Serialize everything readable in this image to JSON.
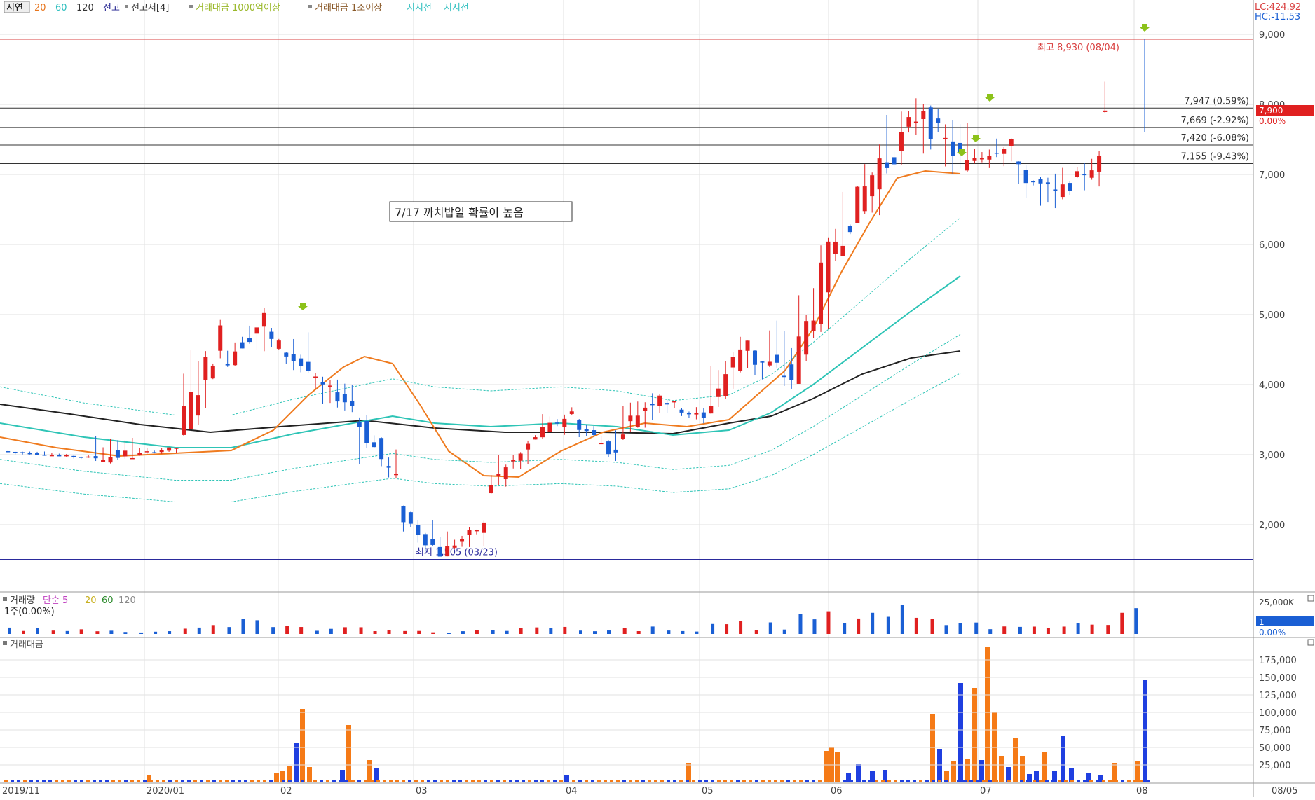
{
  "toolbar": {
    "items": [
      {
        "label": "서연",
        "color": "#000000",
        "boxed": true
      },
      {
        "label": "20",
        "color": "#e8761e"
      },
      {
        "label": "60",
        "color": "#2fbfbf"
      },
      {
        "label": "120",
        "color": "#333333"
      },
      {
        "label": "전고",
        "color": "#1a1a8c"
      },
      {
        "label": "전고저[4]",
        "color": "#333333"
      },
      {
        "label": "거래대금 1000억이상",
        "color": "#9ab82a"
      },
      {
        "label": "거래대금 1조이상",
        "color": "#8a5a2a"
      },
      {
        "label": "지지선",
        "color": "#2fbfbf"
      },
      {
        "label": "지지선",
        "color": "#2fbfbf"
      }
    ]
  },
  "top_right": {
    "lc": "LC:424.92",
    "hc": "HC:-11.53"
  },
  "price_axis": {
    "ticks": [
      "9,000",
      "8,000",
      "7,000",
      "6,000",
      "5,000",
      "4,000",
      "3,000",
      "2,000"
    ],
    "current_price": "7,900",
    "current_change": "0.00%"
  },
  "levels": [
    {
      "label": "최고 8,930 (08/04)",
      "value": 8930,
      "color": "#d94040"
    },
    {
      "label": "7,947 (0.59%)",
      "value": 7947,
      "color": "#333333"
    },
    {
      "label": "7,669 (-2.92%)",
      "value": 7669,
      "color": "#333333"
    },
    {
      "label": "7,420 (-6.08%)",
      "value": 7420,
      "color": "#333333"
    },
    {
      "label": "7,155 (-9.43%)",
      "value": 7155,
      "color": "#333333"
    },
    {
      "label": "최저 1,505 (03/23)",
      "value": 1505,
      "color": "#2a2a9c"
    }
  ],
  "annotation": {
    "text": "7/17  까치밥일  확률이  높음"
  },
  "volume_panel": {
    "legend": [
      {
        "label": "거래량",
        "color": "#333333"
      },
      {
        "label": "단순 5",
        "color": "#c040c0"
      },
      {
        "label": "20",
        "color": "#c8b020"
      },
      {
        "label": "60",
        "color": "#2a8a2a"
      },
      {
        "label": "120",
        "color": "#888888"
      }
    ],
    "sub": "1주(0.00%)",
    "ticks": [
      "25,000K"
    ],
    "current": "1",
    "current_change": "0.00%"
  },
  "amount_panel": {
    "legend": "거래대금",
    "ticks": [
      "175,000",
      "150,000",
      "125,000",
      "100,000",
      "75,000",
      "50,000",
      "25,000"
    ]
  },
  "x_axis": {
    "labels": [
      "2019/11",
      "2020/01",
      "02",
      "03",
      "04",
      "05",
      "06",
      "07",
      "08",
      "08/05"
    ]
  },
  "colors": {
    "up": "#e02020",
    "down": "#1a5fd4",
    "ma20": "#ef7b1f",
    "ma60": "#2ec4b6",
    "ma120": "#222222",
    "amount_orange": "#f57a16",
    "amount_blue": "#1f3fe0",
    "arrow": "#8cc21a"
  },
  "chart_data": {
    "type": "candlestick",
    "x_range": [
      "2019-11",
      "2020-08-05"
    ],
    "ylim": [
      1500,
      9200
    ],
    "ohlc_weekly_approx": [
      {
        "x": "2019-11",
        "o": 3050,
        "h": 3080,
        "l": 2980,
        "c": 3000
      },
      {
        "x": "2019-12",
        "o": 3000,
        "h": 3050,
        "l": 2920,
        "c": 2960
      },
      {
        "x": "2020-01",
        "o": 2960,
        "h": 3600,
        "l": 2850,
        "c": 3000
      },
      {
        "x": "2020-01b",
        "o": 3000,
        "h": 3150,
        "l": 2980,
        "c": 3100
      },
      {
        "x": "2020-02",
        "o": 3300,
        "h": 5000,
        "l": 3250,
        "c": 4700
      },
      {
        "x": "2020-02b",
        "o": 4300,
        "h": 5400,
        "l": 4200,
        "c": 4950
      },
      {
        "x": "2020-02c",
        "o": 4700,
        "h": 5100,
        "l": 4100,
        "c": 4200
      },
      {
        "x": "2020-03",
        "o": 4100,
        "h": 4200,
        "l": 3500,
        "c": 3700
      },
      {
        "x": "2020-03b",
        "o": 3600,
        "h": 3700,
        "l": 2500,
        "c": 2600
      },
      {
        "x": "2020-03c",
        "o": 2200,
        "h": 2300,
        "l": 1505,
        "c": 1600
      },
      {
        "x": "2020-03d",
        "o": 1600,
        "h": 2100,
        "l": 1550,
        "c": 2000
      },
      {
        "x": "2020-04",
        "o": 2500,
        "h": 3300,
        "l": 2400,
        "c": 3100
      },
      {
        "x": "2020-04b",
        "o": 3200,
        "h": 3800,
        "l": 3200,
        "c": 3600
      },
      {
        "x": "2020-04c",
        "o": 3500,
        "h": 3550,
        "l": 2800,
        "c": 3000
      },
      {
        "x": "2020-05",
        "o": 3300,
        "h": 4100,
        "l": 3200,
        "c": 3900
      },
      {
        "x": "2020-05b",
        "o": 3800,
        "h": 3900,
        "l": 3350,
        "c": 3500
      },
      {
        "x": "2020-06",
        "o": 3600,
        "h": 4900,
        "l": 3550,
        "c": 4700
      },
      {
        "x": "2020-06b",
        "o": 4400,
        "h": 5300,
        "l": 3800,
        "c": 4100
      },
      {
        "x": "2020-06c",
        "o": 4200,
        "h": 6400,
        "l": 4100,
        "c": 6100
      },
      {
        "x": "2020-06d",
        "o": 6000,
        "h": 7700,
        "l": 5900,
        "c": 7200
      },
      {
        "x": "2020-07",
        "o": 7000,
        "h": 8450,
        "l": 6900,
        "c": 8000
      },
      {
        "x": "2020-07b",
        "o": 7800,
        "h": 8100,
        "l": 6700,
        "c": 7100
      },
      {
        "x": "2020-07c",
        "o": 7200,
        "h": 7800,
        "l": 6800,
        "c": 7500
      },
      {
        "x": "2020-07d",
        "o": 7100,
        "h": 7200,
        "l": 6200,
        "c": 6700
      },
      {
        "x": "2020-07e",
        "o": 6700,
        "h": 7400,
        "l": 6600,
        "c": 7200
      },
      {
        "x": "2020-08-04",
        "o": 7900,
        "h": 8930,
        "l": 7600,
        "c": 7900
      }
    ],
    "ma20": [
      [
        0,
        3250
      ],
      [
        80,
        3100
      ],
      [
        170,
        2980
      ],
      [
        250,
        3020
      ],
      [
        330,
        3060
      ],
      [
        390,
        3350
      ],
      [
        440,
        3850
      ],
      [
        490,
        4250
      ],
      [
        520,
        4400
      ],
      [
        560,
        4300
      ],
      [
        600,
        3700
      ],
      [
        640,
        3050
      ],
      [
        690,
        2700
      ],
      [
        740,
        2680
      ],
      [
        800,
        3050
      ],
      [
        860,
        3320
      ],
      [
        920,
        3450
      ],
      [
        980,
        3400
      ],
      [
        1040,
        3500
      ],
      [
        1080,
        3850
      ],
      [
        1120,
        4200
      ],
      [
        1160,
        4800
      ],
      [
        1200,
        5600
      ],
      [
        1240,
        6300
      ],
      [
        1280,
        6950
      ],
      [
        1320,
        7050
      ],
      [
        1370,
        7010
      ]
    ],
    "ma60": [
      [
        0,
        3450
      ],
      [
        120,
        3250
      ],
      [
        250,
        3100
      ],
      [
        330,
        3100
      ],
      [
        420,
        3300
      ],
      [
        520,
        3480
      ],
      [
        560,
        3550
      ],
      [
        620,
        3450
      ],
      [
        700,
        3400
      ],
      [
        800,
        3450
      ],
      [
        880,
        3400
      ],
      [
        960,
        3280
      ],
      [
        1040,
        3350
      ],
      [
        1100,
        3600
      ],
      [
        1160,
        4000
      ],
      [
        1220,
        4450
      ],
      [
        1300,
        5050
      ],
      [
        1370,
        5550
      ]
    ],
    "ma120": [
      [
        0,
        3720
      ],
      [
        100,
        3580
      ],
      [
        200,
        3430
      ],
      [
        300,
        3320
      ],
      [
        400,
        3400
      ],
      [
        520,
        3490
      ],
      [
        620,
        3380
      ],
      [
        720,
        3320
      ],
      [
        860,
        3320
      ],
      [
        960,
        3300
      ],
      [
        1040,
        3450
      ],
      [
        1100,
        3550
      ],
      [
        1160,
        3800
      ],
      [
        1230,
        4150
      ],
      [
        1300,
        4380
      ],
      [
        1370,
        4480
      ]
    ]
  }
}
